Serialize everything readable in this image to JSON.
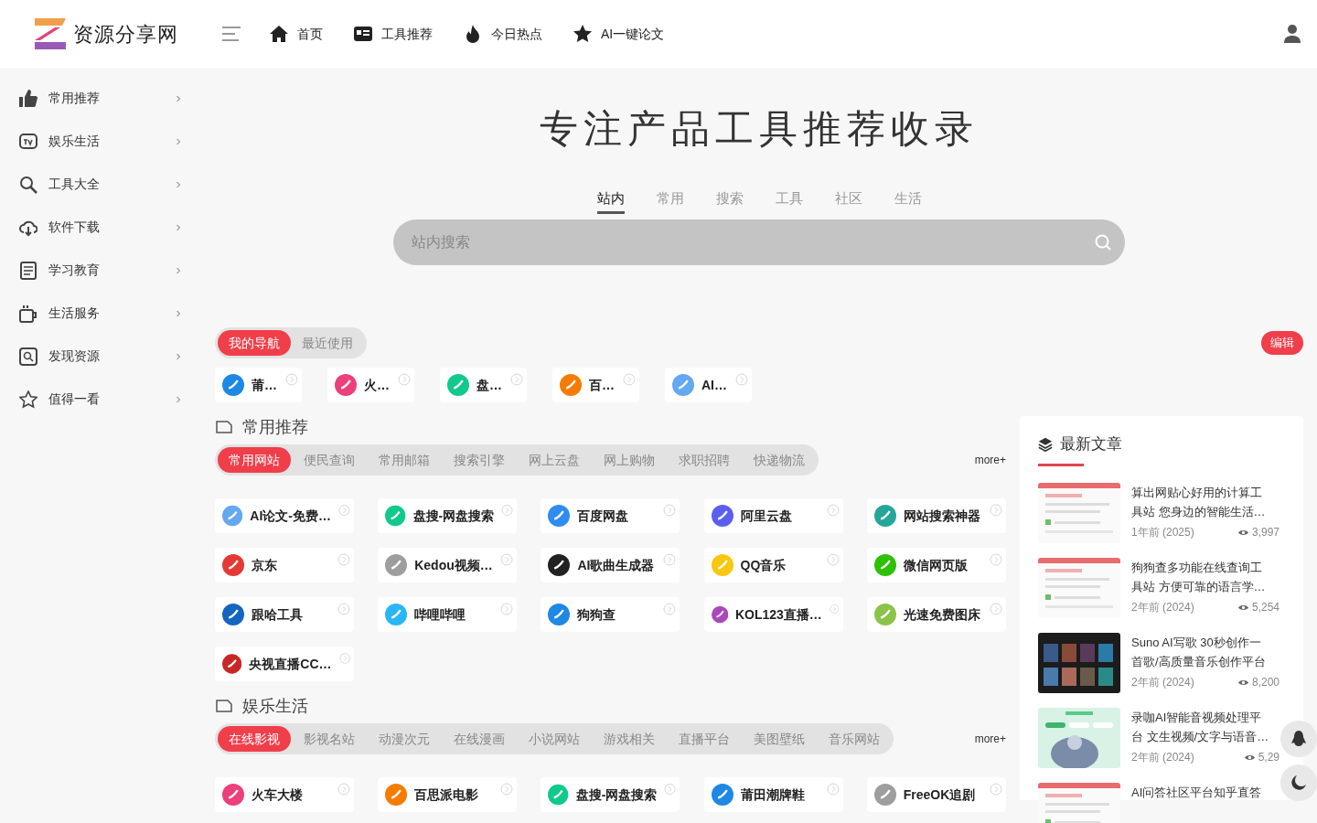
{
  "logo": {
    "text": "资源分享网"
  },
  "nav": [
    {
      "label": "首页",
      "kind": "home"
    },
    {
      "label": "工具推荐",
      "kind": "card"
    },
    {
      "label": "今日热点",
      "kind": "fire"
    },
    {
      "label": "AI一键论文",
      "kind": "star"
    }
  ],
  "sidebar": {
    "items": [
      {
        "label": "常用推荐",
        "kind": "thumb"
      },
      {
        "label": "娱乐生活",
        "kind": "tv"
      },
      {
        "label": "工具大全",
        "kind": "tool"
      },
      {
        "label": "软件下载",
        "kind": "cloud"
      },
      {
        "label": "学习教育",
        "kind": "doc"
      },
      {
        "label": "生活服务",
        "kind": "cup"
      },
      {
        "label": "发现资源",
        "kind": "search"
      },
      {
        "label": "值得一看",
        "kind": "star"
      }
    ]
  },
  "hero": {
    "title": "专注产品工具推荐收录"
  },
  "search": {
    "tabs": [
      {
        "label": "站内",
        "selected": true
      },
      {
        "label": "常用",
        "selected": false
      },
      {
        "label": "搜索",
        "selected": false
      },
      {
        "label": "工具",
        "selected": false
      },
      {
        "label": "社区",
        "selected": false
      },
      {
        "label": "生活",
        "selected": false
      }
    ],
    "placeholder": "站内搜索"
  },
  "my_nav": {
    "tabs": [
      {
        "label": "我的导航",
        "selected": true
      },
      {
        "label": "最近使用",
        "selected": false
      }
    ],
    "edit_button": "编辑",
    "sites": [
      {
        "name": "莆…",
        "color": "#1e88e5"
      },
      {
        "name": "火…",
        "color": "#ec407a"
      },
      {
        "name": "盘…",
        "color": "#10c98a"
      },
      {
        "name": "百…",
        "color": "#f57c00"
      },
      {
        "name": "AI…",
        "color": "#64a8f0"
      }
    ]
  },
  "sections": [
    {
      "title": "常用推荐",
      "more": "more+",
      "tabs": [
        {
          "label": "常用网站",
          "selected": true
        },
        {
          "label": "便民查询",
          "selected": false
        },
        {
          "label": "常用邮箱",
          "selected": false
        },
        {
          "label": "搜索引擎",
          "selected": false
        },
        {
          "label": "网上云盘",
          "selected": false
        },
        {
          "label": "网上购物",
          "selected": false
        },
        {
          "label": "求职招聘",
          "selected": false
        },
        {
          "label": "快递物流",
          "selected": false
        }
      ],
      "sites": [
        {
          "name": "AI论文-免费…",
          "color": "#64a8f0"
        },
        {
          "name": "盘搜-网盘搜索",
          "color": "#10c98a"
        },
        {
          "name": "百度网盘",
          "color": "#2f8cf0"
        },
        {
          "name": "阿里云盘",
          "color": "#5b5ff0"
        },
        {
          "name": "网站搜索神器",
          "color": "#26a69a"
        },
        {
          "name": "京东",
          "color": "#e53935"
        },
        {
          "name": "Kedou视频…",
          "color": "#9e9e9e"
        },
        {
          "name": "AI歌曲生成器",
          "color": "#222222"
        },
        {
          "name": "QQ音乐",
          "color": "#f9c80e"
        },
        {
          "name": "微信网页版",
          "color": "#2dc100"
        },
        {
          "name": "跟哈工具",
          "color": "#1565c0"
        },
        {
          "name": "哔哩哔哩",
          "color": "#29b6f6"
        },
        {
          "name": "狗狗查",
          "color": "#1e88e5"
        },
        {
          "name": "KOL123直播…",
          "color": "#ab47bc"
        },
        {
          "name": "光速免费图床",
          "color": "#8bc34a"
        },
        {
          "name": "央视直播CC…",
          "color": "#c62828"
        }
      ]
    },
    {
      "title": "娱乐生活",
      "more": "more+",
      "tabs": [
        {
          "label": "在线影视",
          "selected": true
        },
        {
          "label": "影视名站",
          "selected": false
        },
        {
          "label": "动漫次元",
          "selected": false
        },
        {
          "label": "在线漫画",
          "selected": false
        },
        {
          "label": "小说网站",
          "selected": false
        },
        {
          "label": "游戏相关",
          "selected": false
        },
        {
          "label": "直播平台",
          "selected": false
        },
        {
          "label": "美图壁纸",
          "selected": false
        },
        {
          "label": "音乐网站",
          "selected": false
        }
      ],
      "sites": [
        {
          "name": "火车大楼",
          "color": "#ec407a"
        },
        {
          "name": "百思派电影",
          "color": "#f57c00"
        },
        {
          "name": "盘搜-网盘搜索",
          "color": "#10c98a"
        },
        {
          "name": "莆田潮牌鞋",
          "color": "#1e88e5"
        },
        {
          "name": "FreeOK追剧",
          "color": "#9e9e9e"
        }
      ]
    }
  ],
  "articles": {
    "title": "最新文章",
    "items": [
      {
        "title": "算出网贴心好用的计算工具站 您身边的智能生活…",
        "time": "1年前 (2025)",
        "views": "3,997",
        "kind": "light"
      },
      {
        "title": "狗狗查多功能在线查询工具站 方便可靠的语言学…",
        "time": "2年前 (2024)",
        "views": "5,254",
        "kind": "light"
      },
      {
        "title": "Suno AI写歌 30秒创作一首歌/高质量音乐创作平台",
        "time": "2年前 (2024)",
        "views": "8,200",
        "kind": "dark"
      },
      {
        "title": "录咖AI智能音视频处理平台 文生视频/文字与语音…",
        "time": "2年前 (2024)",
        "views": "5,29",
        "kind": "green"
      },
      {
        "title": "AI问答社区平台知乎直答",
        "kind": "light"
      }
    ]
  }
}
